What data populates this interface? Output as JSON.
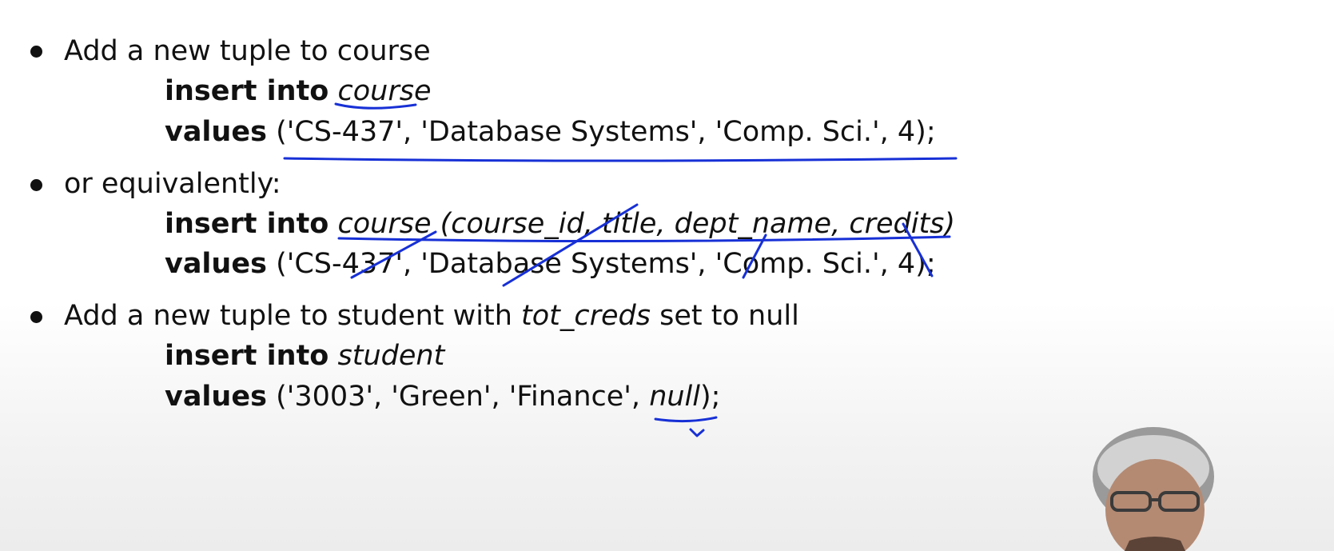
{
  "bullets": [
    {
      "text": "Add a new tuple to course",
      "query": {
        "line1_kw": "insert into",
        "line1_rest": "course",
        "line2_kw": "values",
        "line2_rest": "('CS-437', 'Database Systems', 'Comp. Sci.', 4);"
      }
    },
    {
      "text": "or equivalently:",
      "query": {
        "line1_kw": "insert into",
        "line1_rest": "course (course_id, title, dept_name, credits)",
        "line2_kw": "values",
        "line2_rest": "('CS-437', 'Database Systems', 'Comp. Sci.', 4);"
      }
    },
    {
      "text_before": "Add a new tuple to student with",
      "text_italic": "tot_creds",
      "text_after": "set to null",
      "query": {
        "line1_kw": "insert into",
        "line1_rest": "student",
        "line2_kw": "values",
        "line2_pre": "('3003', 'Green', 'Finance',",
        "line2_italic": "null",
        "line2_post": ");"
      }
    }
  ],
  "colors": {
    "ink": "#1730d6",
    "text": "#111111"
  }
}
